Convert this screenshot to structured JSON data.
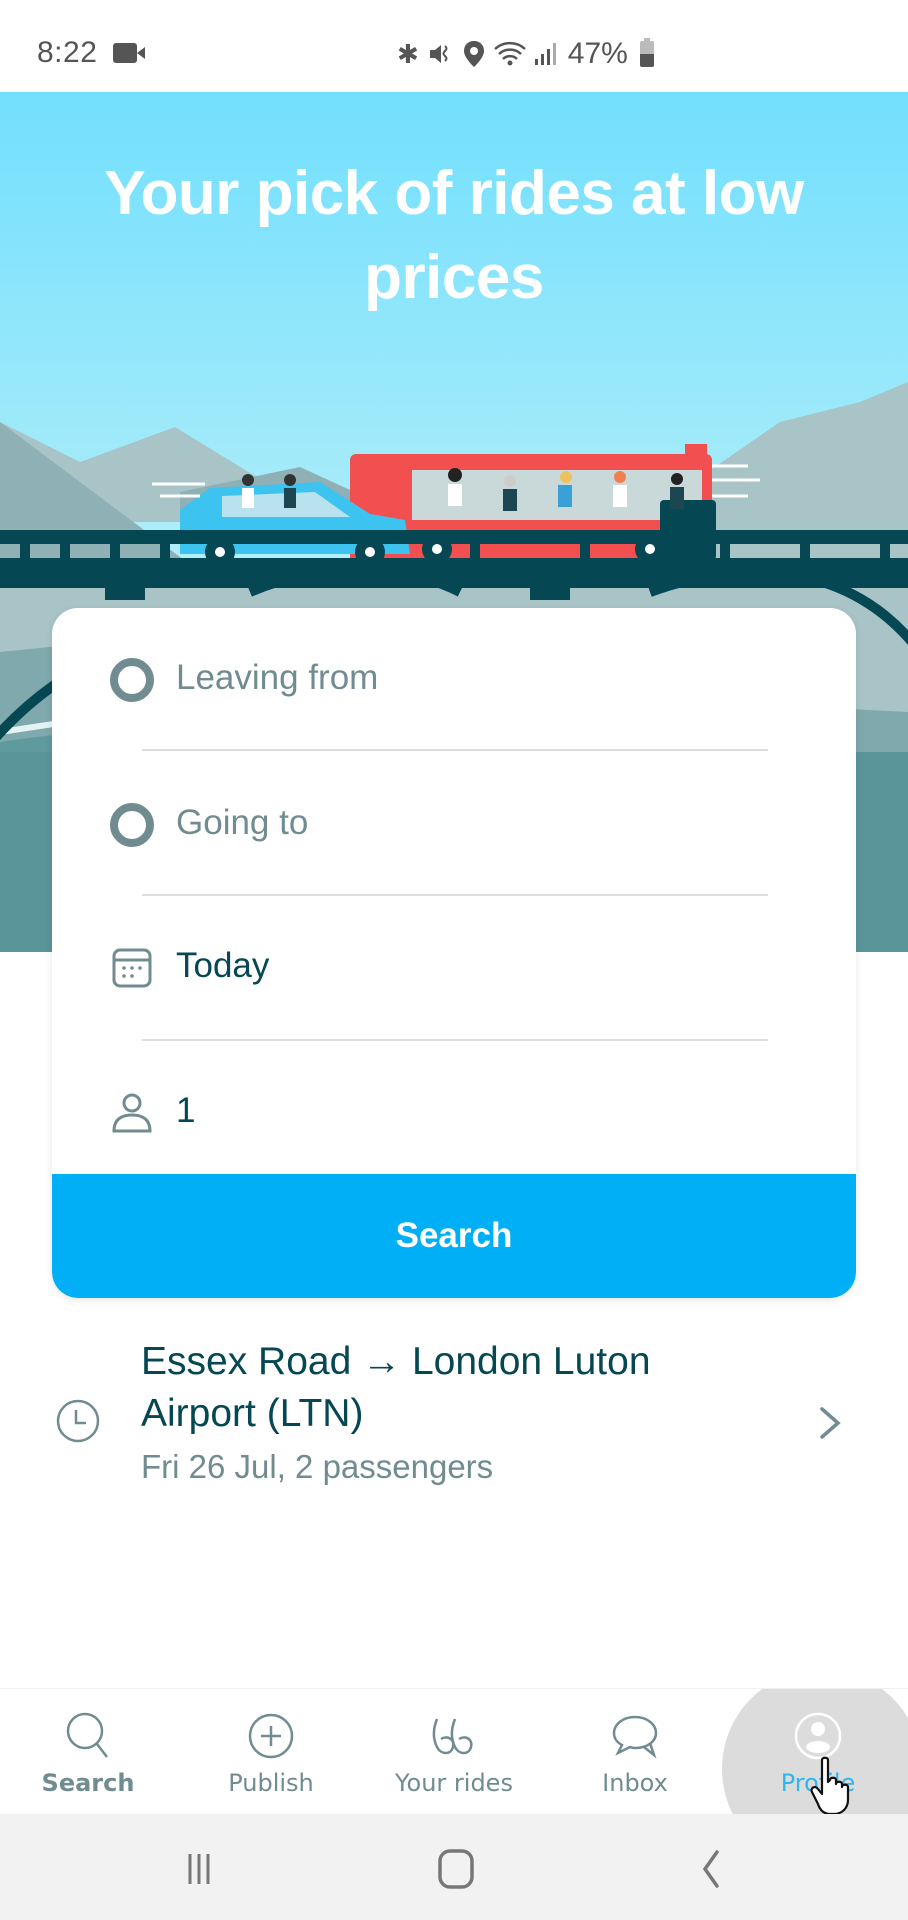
{
  "status_bar": {
    "time": "8:22",
    "battery_percent": "47%",
    "icons": [
      "video-camera-icon",
      "bluetooth-icon",
      "mute-vibrate-icon",
      "location-icon",
      "wifi-icon",
      "signal-icon",
      "battery-icon"
    ]
  },
  "hero": {
    "title": "Your pick of rides at low prices",
    "illustration": "car-and-bus-on-bridge"
  },
  "search_form": {
    "leaving_from_placeholder": "Leaving from",
    "going_to_placeholder": "Going to",
    "date_value": "Today",
    "passengers_value": "1",
    "search_button": "Search"
  },
  "recent_search": {
    "route": "Essex Road → London Luton Airport (LTN)",
    "details": "Fri 26 Jul, 2 passengers"
  },
  "bottom_nav": {
    "items": [
      {
        "label": "Search",
        "icon": "search-icon",
        "active": true
      },
      {
        "label": "Publish",
        "icon": "plus-circle-icon"
      },
      {
        "label": "Your rides",
        "icon": "rides-icon"
      },
      {
        "label": "Inbox",
        "icon": "chat-icon"
      },
      {
        "label": "Profile",
        "icon": "profile-icon",
        "pressed": true
      }
    ]
  },
  "colors": {
    "primary": "#00aff5",
    "text_dark": "#054752",
    "text_muted": "#708c91",
    "bridge": "#054752",
    "bus": "#f25050",
    "car": "#3cc3f0"
  }
}
